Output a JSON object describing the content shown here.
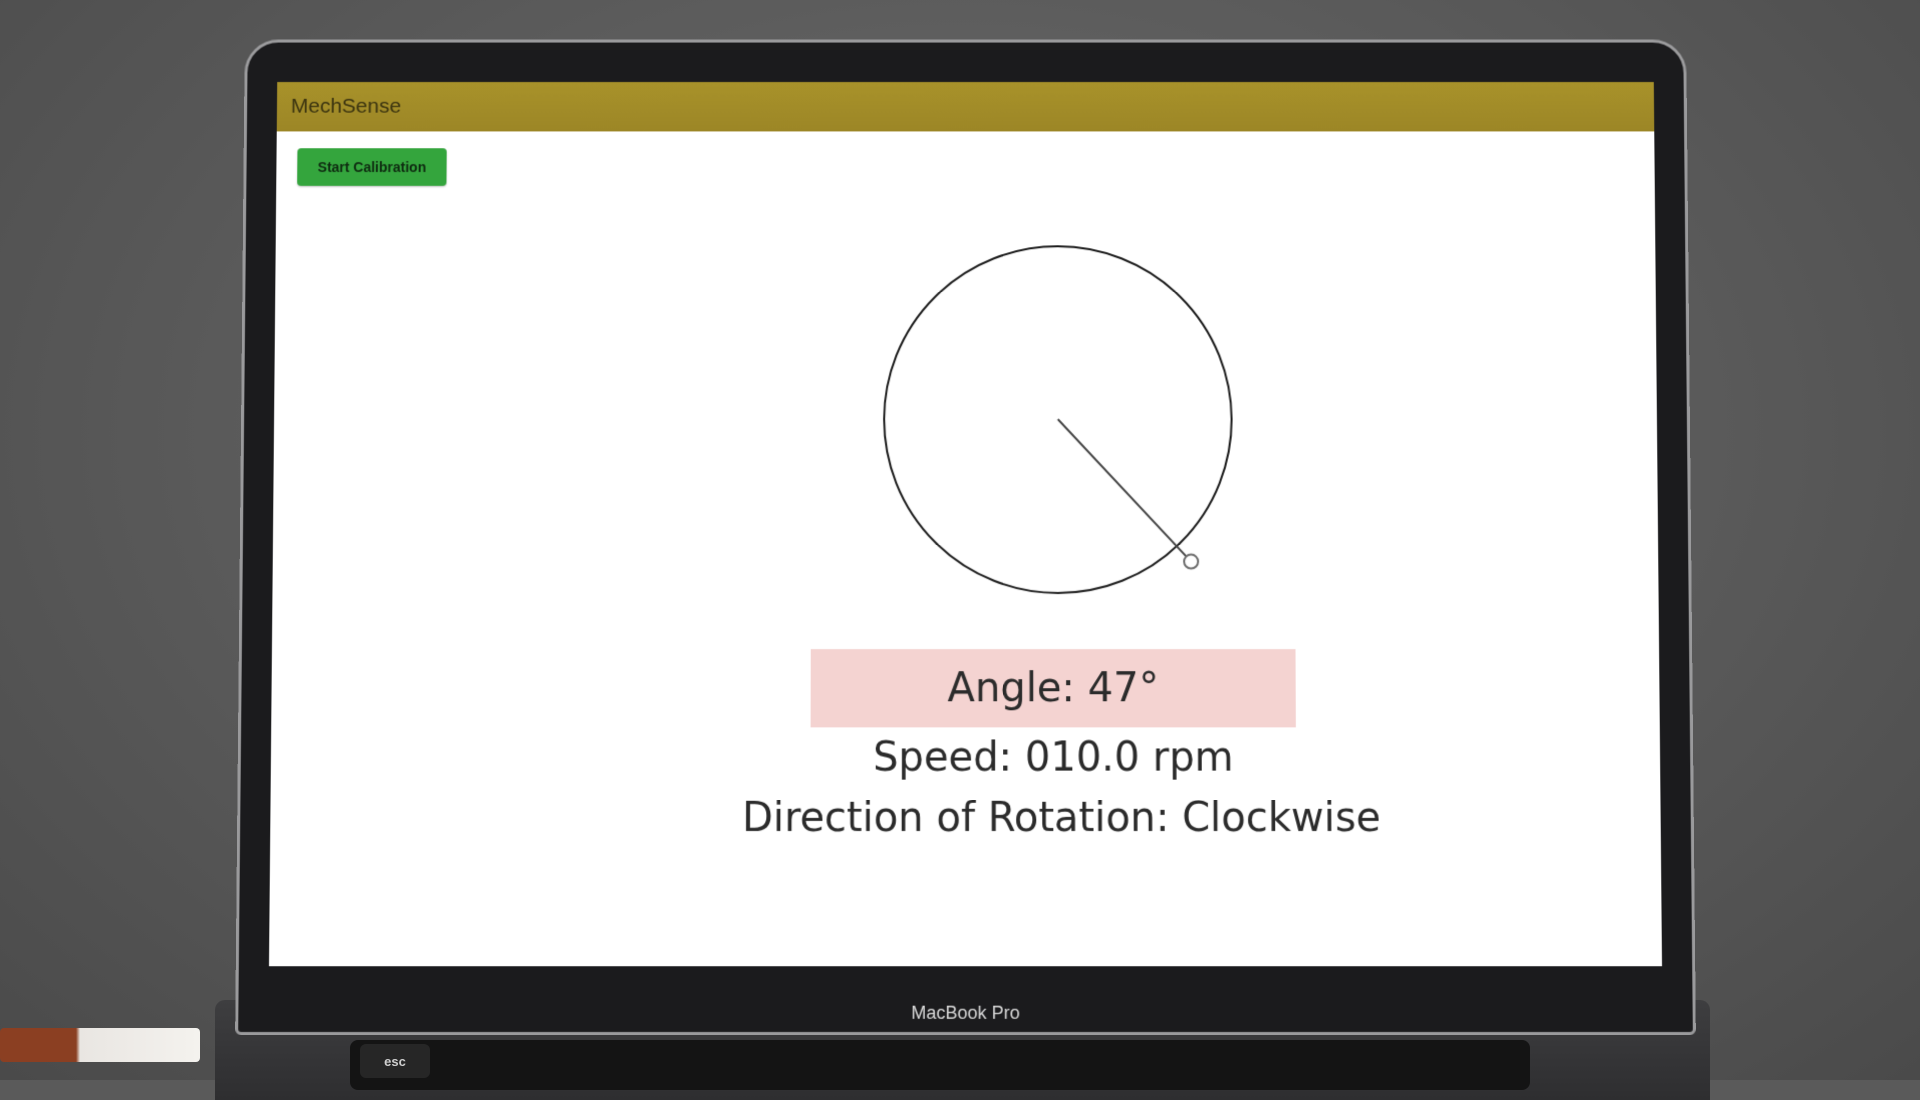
{
  "app": {
    "title": "MechSense"
  },
  "toolbar": {
    "calibration_label": "Start Calibration"
  },
  "gauge": {
    "angle_deg": 47
  },
  "readouts": {
    "angle": "Angle: 47°",
    "speed": "Speed:  010.0 rpm",
    "direction": "Direction of Rotation: Clockwise"
  },
  "device": {
    "label": "MacBook Pro",
    "esc_key": "esc"
  },
  "colors": {
    "app_bar": "#9c8626",
    "button": "#34a53d",
    "angle_highlight": "#f4d3d1"
  }
}
